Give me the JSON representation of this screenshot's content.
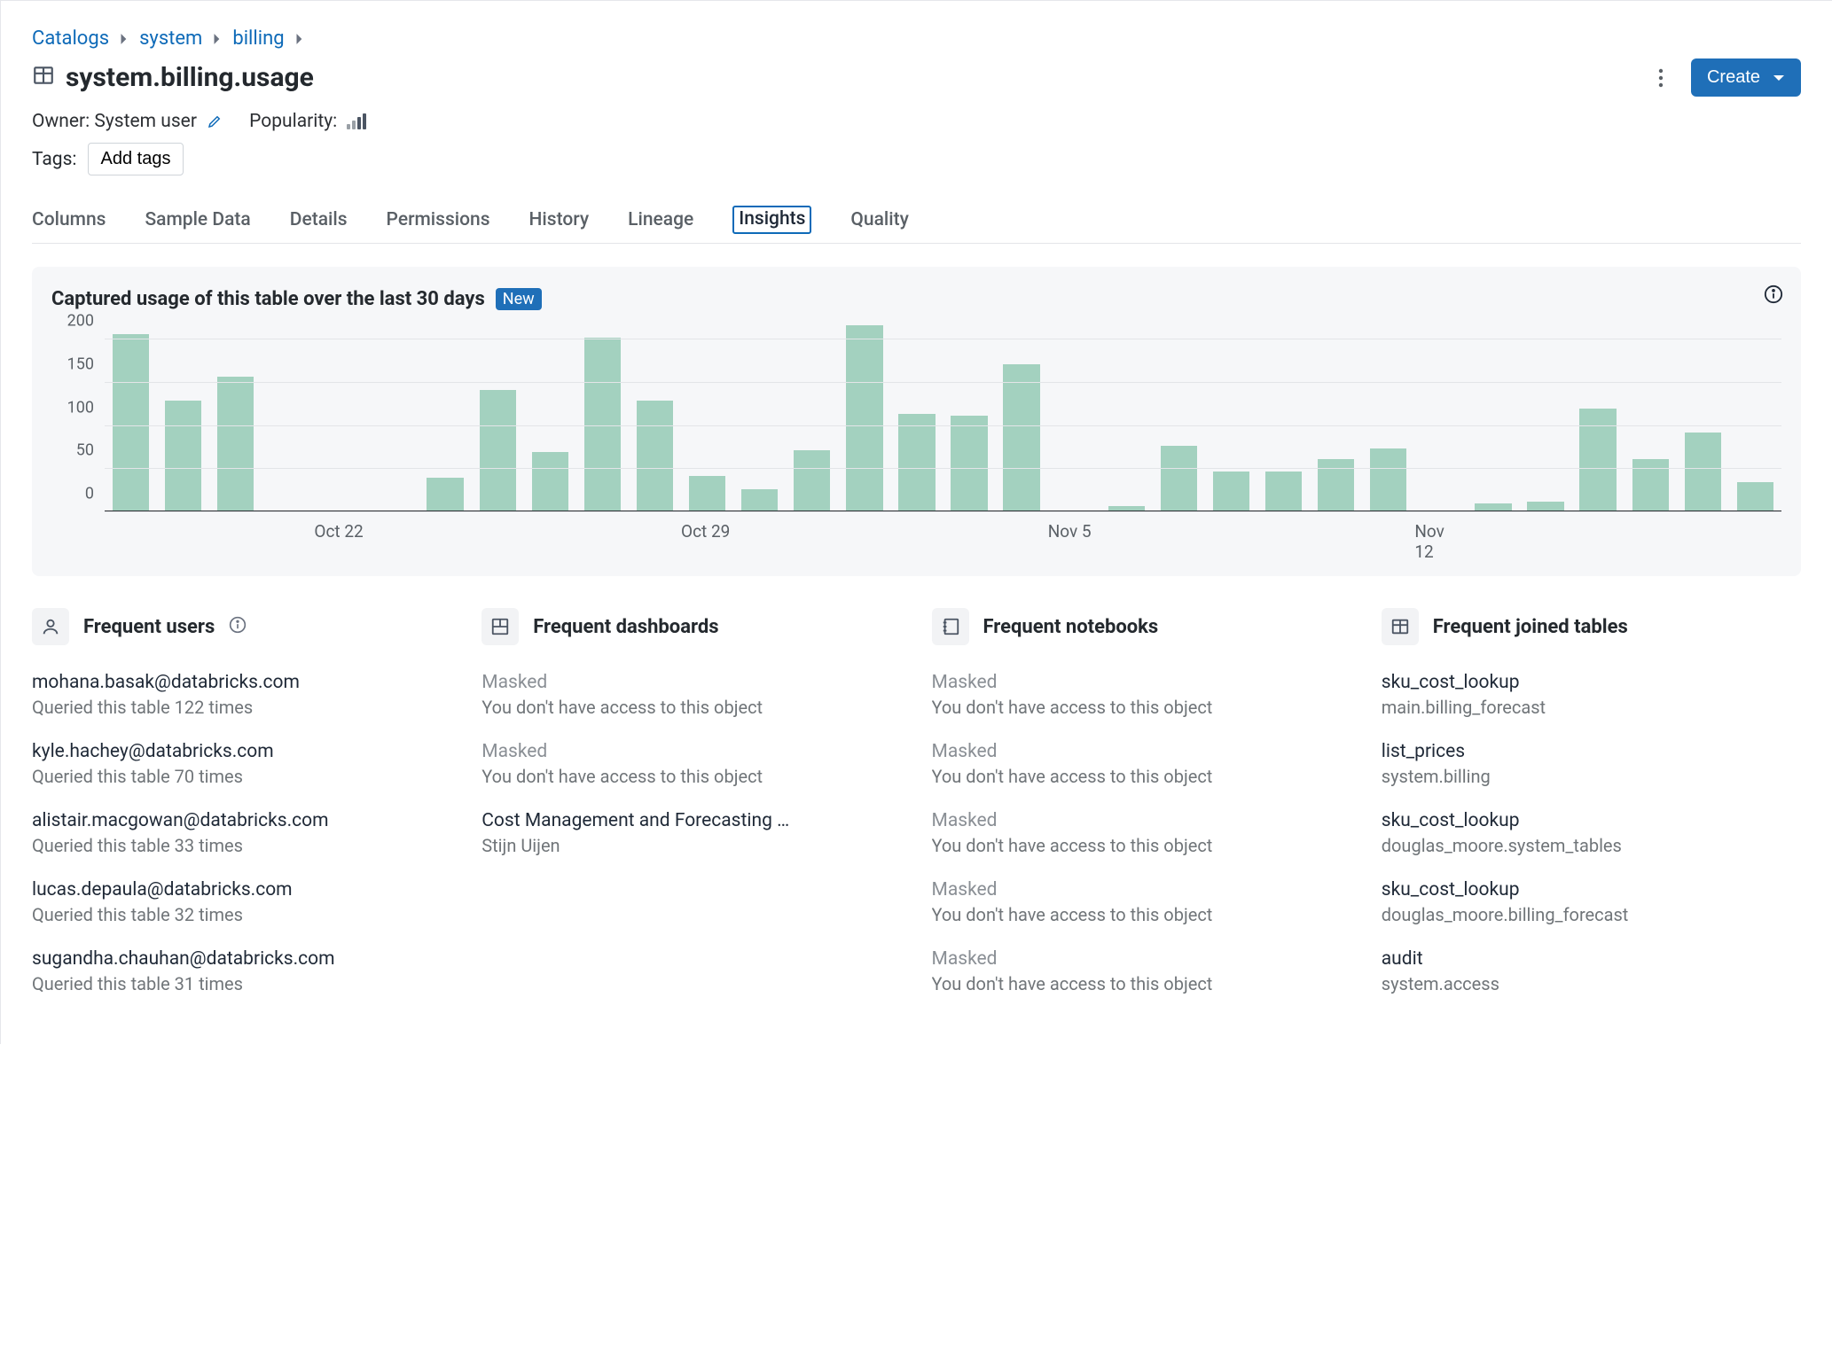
{
  "breadcrumb": {
    "a": "Catalogs",
    "b": "system",
    "c": "billing"
  },
  "title": "system.billing.usage",
  "owner": {
    "label": "Owner:",
    "value": "System user"
  },
  "popularity_label": "Popularity:",
  "tags": {
    "label": "Tags:",
    "add": "Add tags"
  },
  "create_label": "Create",
  "tabs": [
    "Columns",
    "Sample Data",
    "Details",
    "Permissions",
    "History",
    "Lineage",
    "Insights",
    "Quality"
  ],
  "panel": {
    "title": "Captured usage of this table over the last 30 days",
    "badge": "New"
  },
  "chart_data": {
    "type": "bar",
    "title": "Captured usage of this table over the last 30 days",
    "xlabel": "",
    "ylabel": "",
    "ylim": [
      0,
      220
    ],
    "y_ticks": [
      0,
      50,
      100,
      150,
      200
    ],
    "x_tick_labels": [
      "Oct 22",
      "Oct 29",
      "Nov 5",
      "Nov 12"
    ],
    "categories": [
      "Oct 18",
      "Oct 19",
      "Oct 20",
      "Oct 21",
      "Oct 22",
      "Oct 23",
      "Oct 24",
      "Oct 25",
      "Oct 26",
      "Oct 27",
      "Oct 28",
      "Oct 29",
      "Oct 30",
      "Oct 31",
      "Nov 1",
      "Nov 2",
      "Nov 3",
      "Nov 4",
      "Nov 5",
      "Nov 6",
      "Nov 7",
      "Nov 8",
      "Nov 9",
      "Nov 10",
      "Nov 11",
      "Nov 12",
      "Nov 13",
      "Nov 14",
      "Nov 15",
      "Nov 16",
      "Nov 17"
    ],
    "values": [
      205,
      127,
      155,
      0,
      0,
      0,
      38,
      140,
      68,
      200,
      128,
      40,
      25,
      70,
      215,
      112,
      110,
      170,
      0,
      5,
      75,
      45,
      45,
      60,
      72,
      0,
      8,
      10,
      118,
      60,
      90,
      33
    ]
  },
  "cards": {
    "users": {
      "title": "Frequent users",
      "items": [
        {
          "l1": "mohana.basak@databricks.com",
          "l2": "Queried this table 122 times"
        },
        {
          "l1": "kyle.hachey@databricks.com",
          "l2": "Queried this table 70 times"
        },
        {
          "l1": "alistair.macgowan@databricks.com",
          "l2": "Queried this table 33 times"
        },
        {
          "l1": "lucas.depaula@databricks.com",
          "l2": "Queried this table 32 times"
        },
        {
          "l1": "sugandha.chauhan@databricks.com",
          "l2": "Queried this table 31 times"
        }
      ]
    },
    "dashboards": {
      "title": "Frequent dashboards",
      "items": [
        {
          "masked": true,
          "l1": "Masked",
          "l2": "You don't have access to this object"
        },
        {
          "masked": true,
          "l1": "Masked",
          "l2": "You don't have access to this object"
        },
        {
          "masked": false,
          "l1": "Cost Management and Forecasting …",
          "l2": "Stijn Uijen"
        }
      ]
    },
    "notebooks": {
      "title": "Frequent notebooks",
      "items": [
        {
          "masked": true,
          "l1": "Masked",
          "l2": "You don't have access to this object"
        },
        {
          "masked": true,
          "l1": "Masked",
          "l2": "You don't have access to this object"
        },
        {
          "masked": true,
          "l1": "Masked",
          "l2": "You don't have access to this object"
        },
        {
          "masked": true,
          "l1": "Masked",
          "l2": "You don't have access to this object"
        },
        {
          "masked": true,
          "l1": "Masked",
          "l2": "You don't have access to this object"
        }
      ]
    },
    "joined": {
      "title": "Frequent joined tables",
      "items": [
        {
          "l1": "sku_cost_lookup",
          "l2": "main.billing_forecast"
        },
        {
          "l1": "list_prices",
          "l2": "system.billing"
        },
        {
          "l1": "sku_cost_lookup",
          "l2": "douglas_moore.system_tables"
        },
        {
          "l1": "sku_cost_lookup",
          "l2": "douglas_moore.billing_forecast"
        },
        {
          "l1": "audit",
          "l2": "system.access"
        }
      ]
    }
  }
}
